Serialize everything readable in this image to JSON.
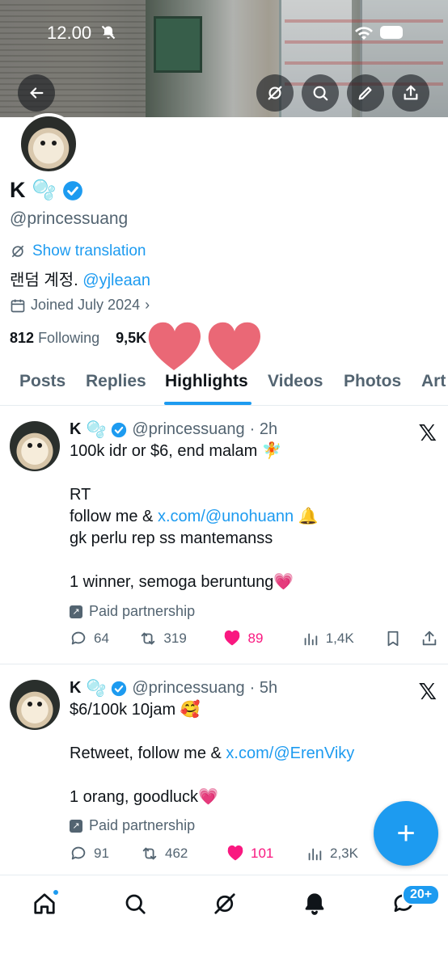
{
  "status_bar": {
    "time": "12.00"
  },
  "profile": {
    "display_name": "K",
    "emoji": "🫧",
    "handle": "@princessuang",
    "show_translation": "Show translation",
    "bio_text": "랜덤 계정.",
    "bio_mention": "@yjleaan",
    "joined": "Joined July 2024",
    "following_count": "812",
    "following_label": "Following",
    "followers_count": "9,5K"
  },
  "tabs": [
    "Posts",
    "Replies",
    "Highlights",
    "Videos",
    "Photos",
    "Art"
  ],
  "active_tab": "Highlights",
  "posts": [
    {
      "name": "K",
      "emoji": "🫧",
      "handle": "@princessuang",
      "time": "· 2h",
      "lines": [
        {
          "text": "100k idr or $6, end malam 🧚"
        },
        {
          "text": ""
        },
        {
          "text": "RT"
        },
        {
          "text": "follow me & ",
          "link": "x.com/@unohuann",
          "suffix": " 🔔"
        },
        {
          "text": "gk perlu rep ss mantemanss"
        },
        {
          "text": ""
        },
        {
          "text": "1 winner, semoga beruntung💗"
        }
      ],
      "paid": "Paid partnership",
      "replies": "64",
      "reposts": "319",
      "likes": "89",
      "views": "1,4K"
    },
    {
      "name": "K",
      "emoji": "🫧",
      "handle": "@princessuang",
      "time": "· 5h",
      "lines": [
        {
          "text": "$6/100k 10jam 🥰"
        },
        {
          "text": ""
        },
        {
          "text": "Retweet, follow me & ",
          "link": "x.com/@ErenViky",
          "suffix": ""
        },
        {
          "text": ""
        },
        {
          "text": "1 orang, goodluck💗"
        }
      ],
      "paid": "Paid partnership",
      "replies": "91",
      "reposts": "462",
      "likes": "101",
      "views": "2,3K"
    }
  ],
  "fab_label": "+",
  "nav_badge": "20+",
  "colors": {
    "accent": "#1d9bf0",
    "like": "#f91880",
    "muted": "#536471"
  }
}
